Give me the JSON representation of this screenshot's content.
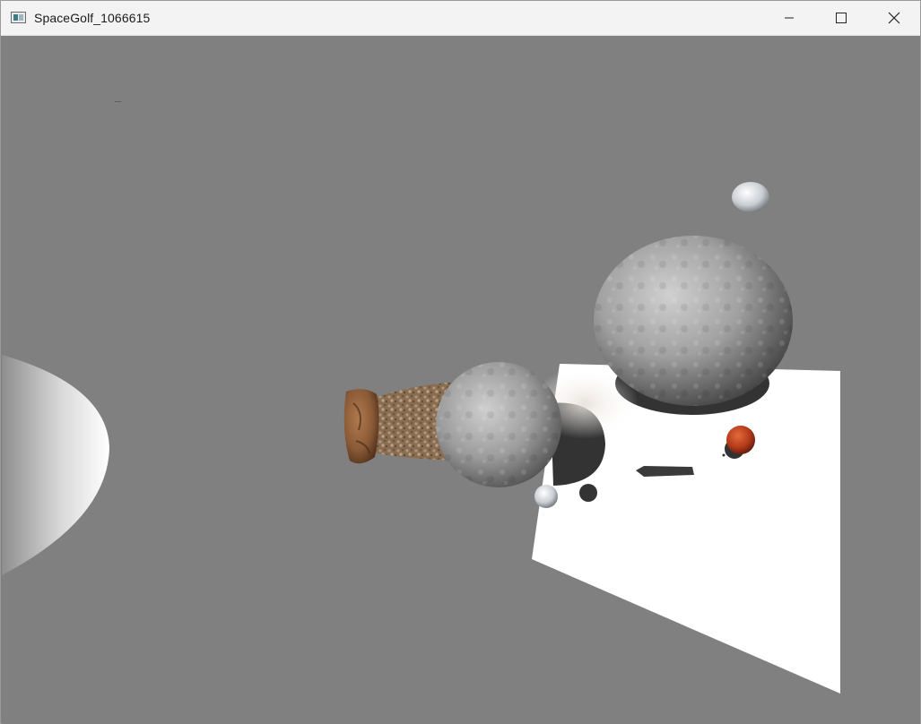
{
  "window": {
    "title": "SpaceGolf_1066615",
    "controls": {
      "minimize_icon": "minimize-icon",
      "maximize_icon": "maximize-icon",
      "close_icon": "close-icon"
    }
  },
  "scene": {
    "background_color": "#808080",
    "objects": [
      "white-hemisphere",
      "brown-asteroid",
      "debris-stream",
      "middle-grey-planet",
      "large-grey-planet",
      "small-ice-moon-top",
      "small-ice-moon-bottom",
      "red-planet",
      "white-ground-plane",
      "planet-shadows"
    ]
  }
}
